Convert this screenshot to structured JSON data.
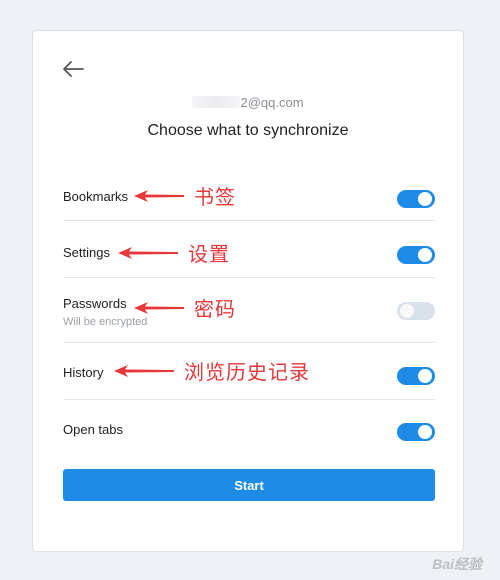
{
  "account": {
    "email_visible": "2@qq.com"
  },
  "title": "Choose what to synchronize",
  "items": [
    {
      "label": "Bookmarks",
      "enabled": true,
      "annotation": "书签"
    },
    {
      "label": "Settings",
      "enabled": true,
      "annotation": "设置"
    },
    {
      "label": "Passwords",
      "sublabel": "Will be encrypted",
      "enabled": false,
      "annotation": "密码"
    },
    {
      "label": "History",
      "enabled": true,
      "annotation": "浏览历史记录"
    },
    {
      "label": "Open tabs",
      "enabled": true
    }
  ],
  "start_label": "Start",
  "watermark": "Bai经验",
  "colors": {
    "accent": "#1e8be6",
    "annotation": "#e5383b",
    "toggle_off": "#d9e1ea"
  }
}
